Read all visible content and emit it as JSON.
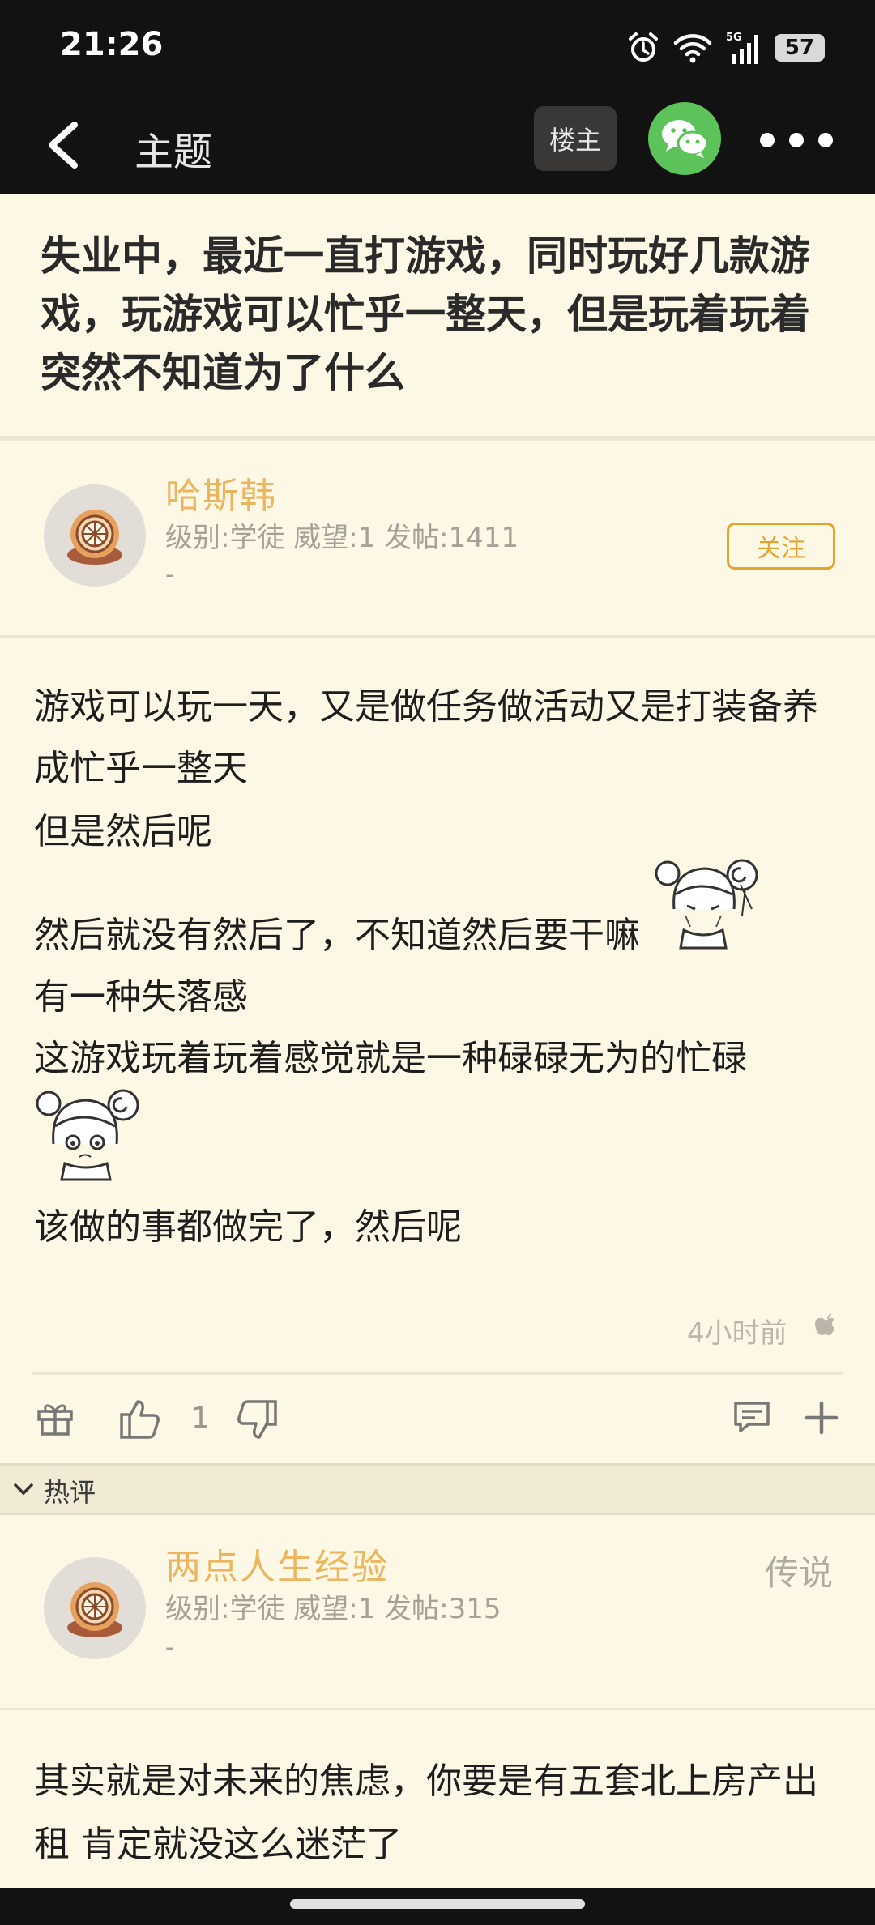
{
  "status_bar": {
    "time": "21:26",
    "network": "5G",
    "battery": "57"
  },
  "nav": {
    "title": "主题",
    "op_label": "楼主"
  },
  "thread": {
    "title": "失业中，最近一直打游戏，同时玩好几款游戏，玩游戏可以忙乎一整天，但是玩着玩着突然不知道为了什么"
  },
  "post": {
    "author": {
      "name": "哈斯韩",
      "meta": "级别:学徒 威望:1 发帖:1411",
      "signature": "-",
      "follow_label": "关注"
    },
    "lines": [
      "游戏可以玩一天，又是做任务做活动又是打装备养",
      "成忙乎一整天",
      "但是然后呢",
      "然后就没有然后了，不知道然后要干嘛",
      "有一种失落感",
      "这游戏玩着玩着感觉就是一种碌碌无为的忙碌",
      "该做的事都做完了，然后呢"
    ],
    "time": "4小时前",
    "like_count": "1"
  },
  "hot_comments": {
    "label": "热评",
    "items": [
      {
        "author": "两点人生经验",
        "meta": "级别:学徒 威望:1 发帖:315",
        "signature": "-",
        "rank": "传说",
        "lines": [
          "其实就是对未来的焦虑，你要是有五套北上房产出",
          "租 肯定就没这么迷茫了"
        ]
      }
    ]
  },
  "icons": {
    "alarm": "alarm-icon",
    "wifi": "wifi-icon",
    "signal": "signal-icon",
    "battery": "battery-icon",
    "back": "back-arrow-icon",
    "wechat": "wechat-icon",
    "more": "more-dots-icon",
    "gift": "gift-icon",
    "like": "thumbs-up-icon",
    "dislike": "thumbs-down-icon",
    "comment": "comment-icon",
    "add": "plus-icon",
    "apple": "apple-icon",
    "collapse": "chevron-down-icon"
  },
  "colors": {
    "background": "#fdf8e6",
    "author": "#ecb55e",
    "follow": "#e8a42a",
    "wechat": "#5cc35a",
    "bar": "#121212"
  }
}
